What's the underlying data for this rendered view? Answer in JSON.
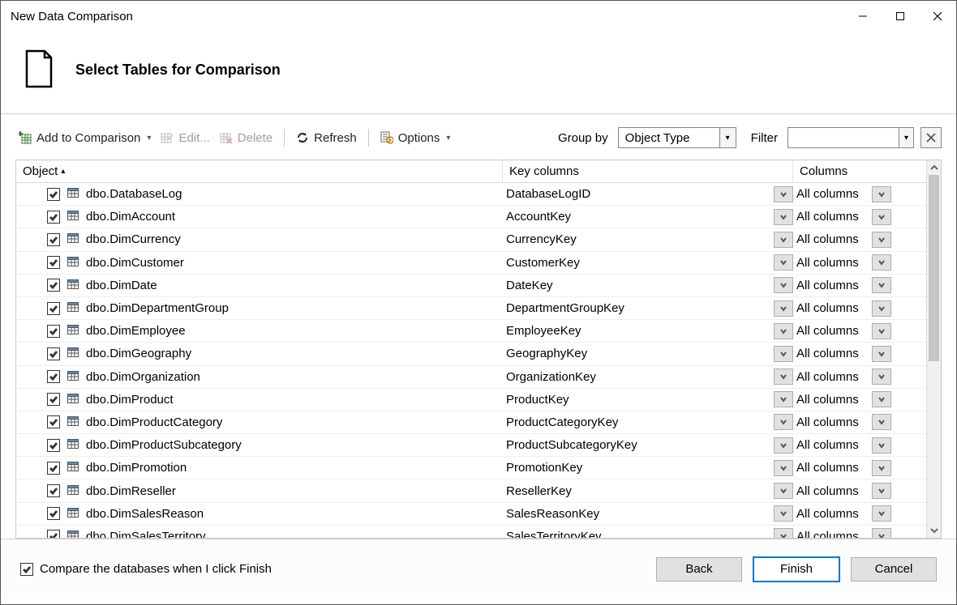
{
  "window": {
    "title": "New Data Comparison"
  },
  "header": {
    "title": "Select Tables for Comparison"
  },
  "toolbar": {
    "add": "Add to Comparison",
    "edit": "Edit...",
    "delete": "Delete",
    "refresh": "Refresh",
    "options": "Options",
    "groupby_label": "Group by",
    "groupby_value": "Object Type",
    "filter_label": "Filter"
  },
  "grid": {
    "headers": {
      "object": "Object",
      "key": "Key columns",
      "columns": "Columns"
    },
    "rows": [
      {
        "name": "dbo.DatabaseLog",
        "key": "DatabaseLogID",
        "cols": "All columns",
        "checked": true
      },
      {
        "name": "dbo.DimAccount",
        "key": "AccountKey",
        "cols": "All columns",
        "checked": true
      },
      {
        "name": "dbo.DimCurrency",
        "key": "CurrencyKey",
        "cols": "All columns",
        "checked": true
      },
      {
        "name": "dbo.DimCustomer",
        "key": "CustomerKey",
        "cols": "All columns",
        "checked": true
      },
      {
        "name": "dbo.DimDate",
        "key": "DateKey",
        "cols": "All columns",
        "checked": true
      },
      {
        "name": "dbo.DimDepartmentGroup",
        "key": "DepartmentGroupKey",
        "cols": "All columns",
        "checked": true
      },
      {
        "name": "dbo.DimEmployee",
        "key": "EmployeeKey",
        "cols": "All columns",
        "checked": true
      },
      {
        "name": "dbo.DimGeography",
        "key": "GeographyKey",
        "cols": "All columns",
        "checked": true
      },
      {
        "name": "dbo.DimOrganization",
        "key": "OrganizationKey",
        "cols": "All columns",
        "checked": true
      },
      {
        "name": "dbo.DimProduct",
        "key": "ProductKey",
        "cols": "All columns",
        "checked": true
      },
      {
        "name": "dbo.DimProductCategory",
        "key": "ProductCategoryKey",
        "cols": "All columns",
        "checked": true
      },
      {
        "name": "dbo.DimProductSubcategory",
        "key": "ProductSubcategoryKey",
        "cols": "All columns",
        "checked": true
      },
      {
        "name": "dbo.DimPromotion",
        "key": "PromotionKey",
        "cols": "All columns",
        "checked": true
      },
      {
        "name": "dbo.DimReseller",
        "key": "ResellerKey",
        "cols": "All columns",
        "checked": true
      },
      {
        "name": "dbo.DimSalesReason",
        "key": "SalesReasonKey",
        "cols": "All columns",
        "checked": true
      },
      {
        "name": "dbo.DimSalesTerritory",
        "key": "SalesTerritoryKey",
        "cols": "All columns",
        "checked": true
      }
    ]
  },
  "footer": {
    "compare_label": "Compare the databases when I click Finish",
    "compare_checked": true,
    "back": "Back",
    "finish": "Finish",
    "cancel": "Cancel"
  }
}
